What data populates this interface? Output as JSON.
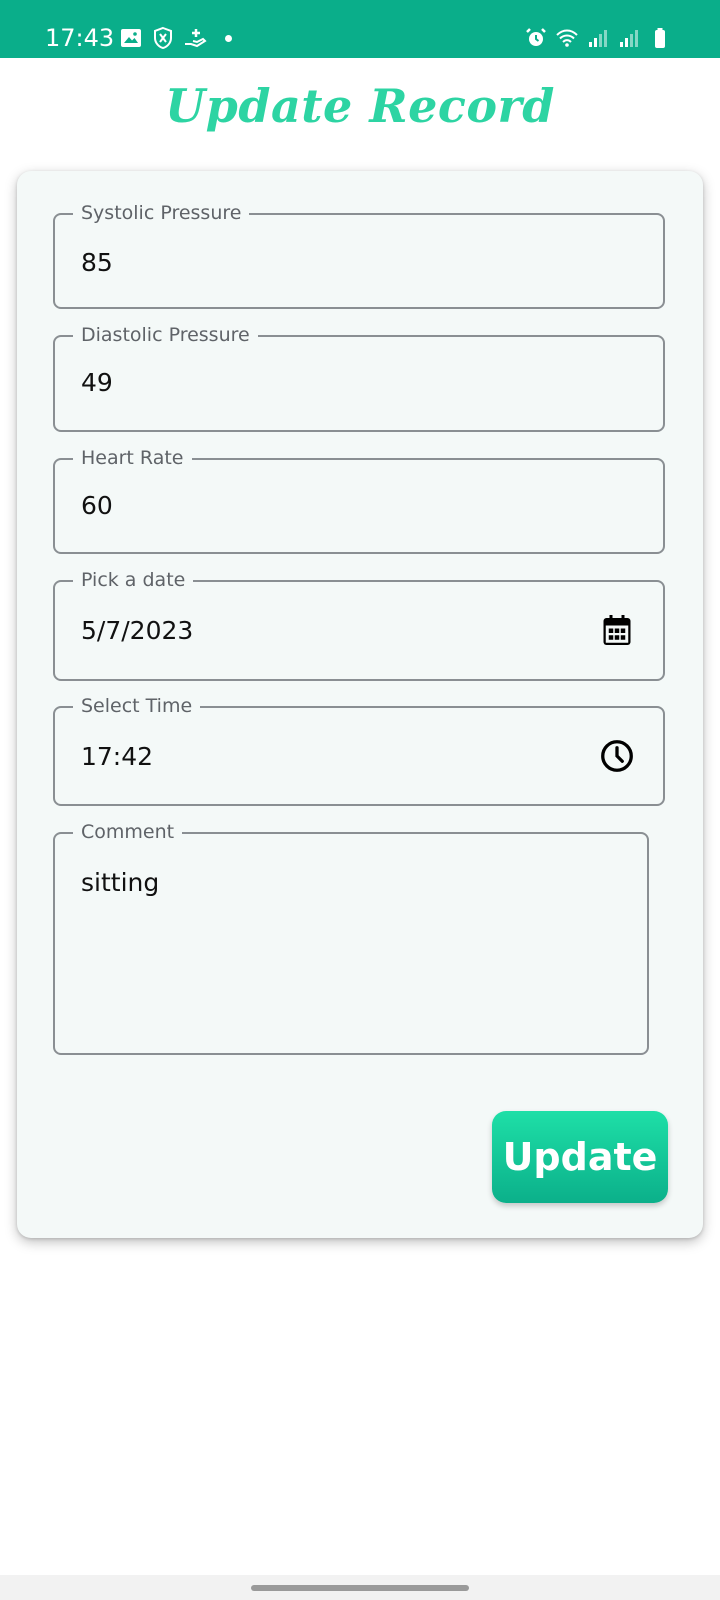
{
  "status_bar": {
    "time": "17:43",
    "left_icons": [
      "image-icon",
      "shield-icon",
      "hand-icon",
      "notification-dot"
    ],
    "right_icons": [
      "alarm-icon",
      "wifi-icon",
      "signal-icon",
      "signal-icon",
      "battery-icon"
    ],
    "color": "#0aae8a"
  },
  "header": {
    "title": "Update Record",
    "title_color": "#2dd4a3"
  },
  "form": {
    "systolic": {
      "label": "Systolic Pressure",
      "value": "85"
    },
    "diastolic": {
      "label": "Diastolic Pressure",
      "value": "49"
    },
    "heart_rate": {
      "label": "Heart Rate",
      "value": "60"
    },
    "date": {
      "label": "Pick a date",
      "value": "5/7/2023",
      "icon": "calendar-icon"
    },
    "time": {
      "label": "Select Time",
      "value": "17:42",
      "icon": "clock-icon"
    },
    "comment": {
      "label": "Comment",
      "value": "sitting"
    },
    "submit_label": "Update"
  },
  "colors": {
    "accent": "#1fd6a3",
    "accent_dark": "#0bb08a",
    "card_bg": "#f4f9f8",
    "border": "#8a8f93"
  }
}
